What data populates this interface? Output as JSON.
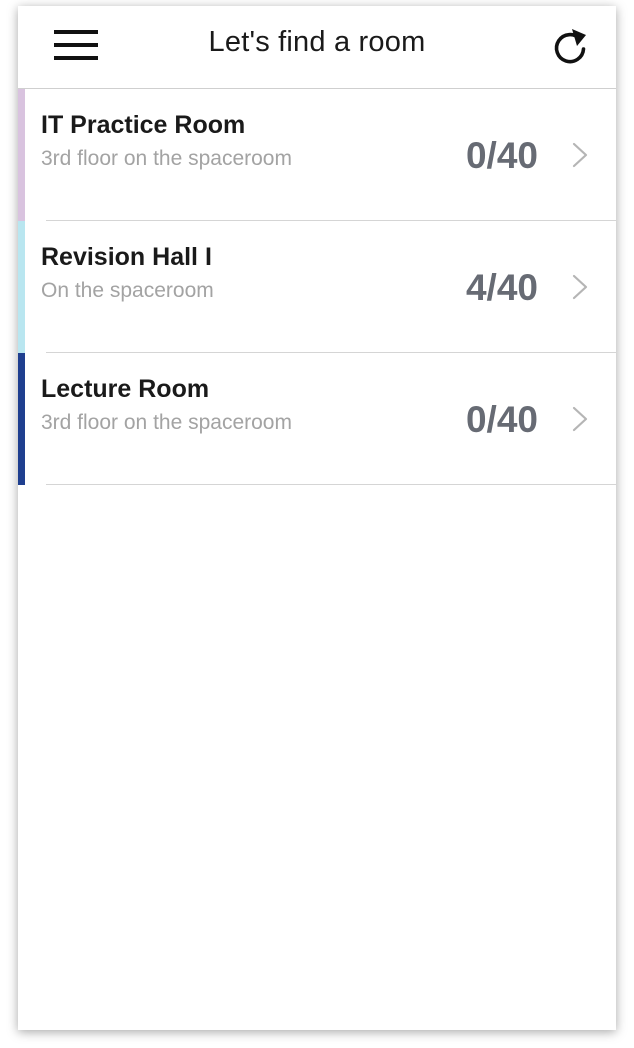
{
  "header": {
    "title": "Let's find a room",
    "menu_icon": "hamburger-menu-icon",
    "refresh_icon": "refresh-icon"
  },
  "rooms": [
    {
      "name": "IT Practice Room",
      "location": "3rd floor on the spaceroom",
      "occupancy": "0/40",
      "accent_color": "#d9c3df"
    },
    {
      "name": "Revision Hall I",
      "location": "On the spaceroom",
      "occupancy": "4/40",
      "accent_color": "#b9e6f0"
    },
    {
      "name": "Lecture Room",
      "location": "3rd floor on the spaceroom",
      "occupancy": "0/40",
      "accent_color": "#1f3f8f"
    }
  ],
  "colors": {
    "title_text": "#1a1a1a",
    "subtitle_text": "#a3a3a3",
    "count_text": "#676b74",
    "chevron": "#b5b5b5"
  }
}
